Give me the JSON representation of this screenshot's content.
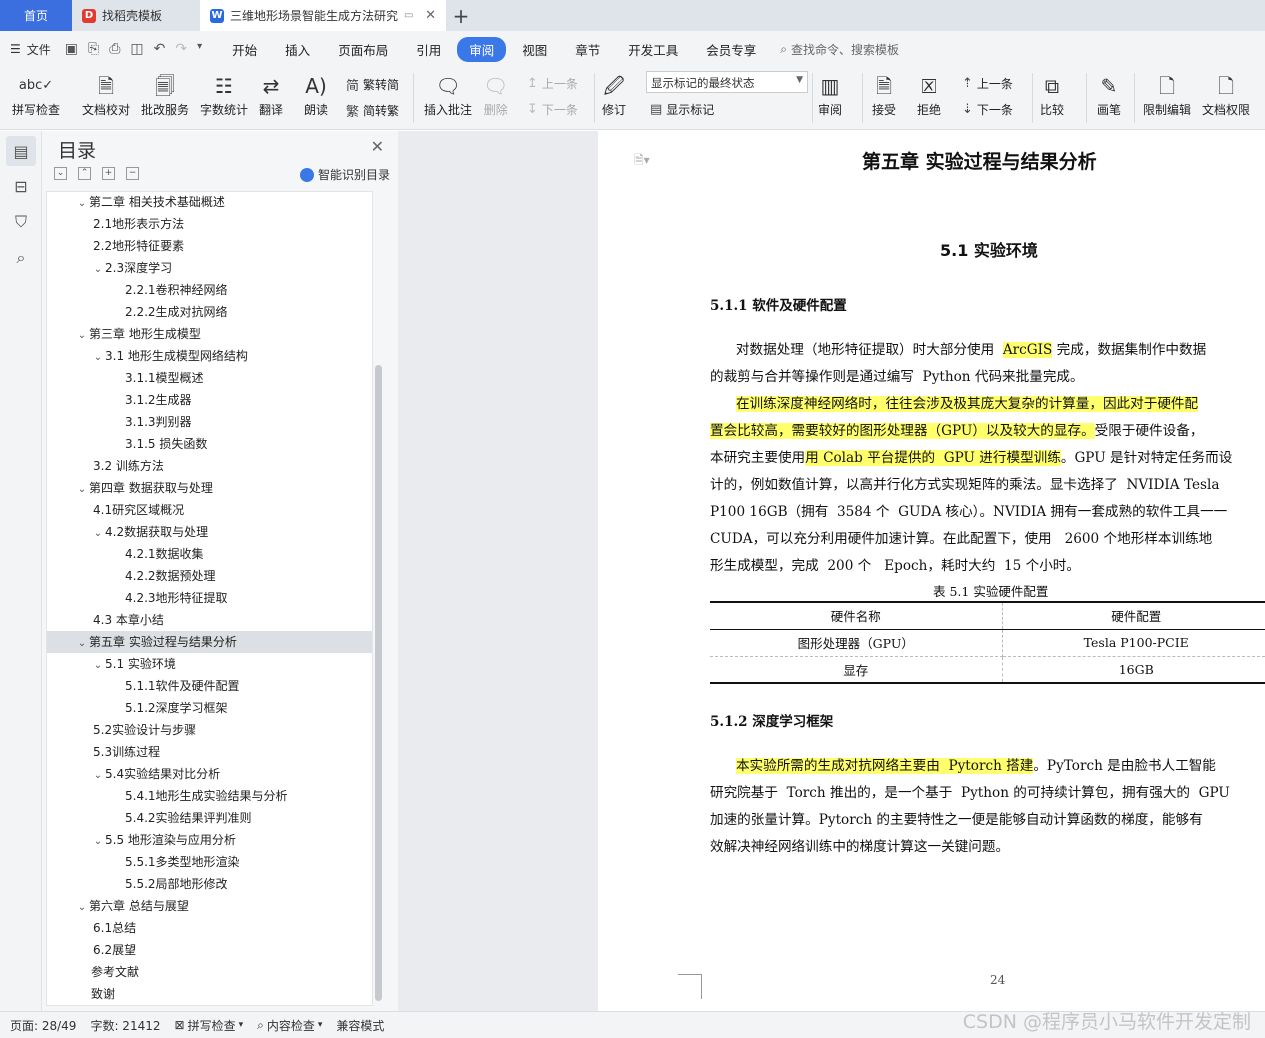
{
  "tabs": {
    "home": "首页",
    "t1": "找稻壳模板",
    "t2": "三维地形场景智能生成方法研究"
  },
  "menubar": {
    "file": "文件",
    "items": [
      "开始",
      "插入",
      "页面布局",
      "引用",
      "审阅",
      "视图",
      "章节",
      "开发工具",
      "会员专享"
    ],
    "active_index": 4,
    "search": "查找命令、搜索模板"
  },
  "ribbon": {
    "spell": "拼写检查",
    "proof": "文档校对",
    "batch": "批改服务",
    "wordcount": "字数统计",
    "translate": "翻译",
    "read": "朗读",
    "trad": "繁转简",
    "simp": "简转繁",
    "insert_comment": "插入批注",
    "delete": "删除",
    "prev": "上一条",
    "next": "下一条",
    "track": "修订",
    "markstate": "显示标记的最终状态",
    "showmarks": "显示标记",
    "review": "审阅",
    "accept": "接受",
    "reject": "拒绝",
    "prev2": "上一条",
    "next2": "下一条",
    "compare": "比较",
    "pen": "画笔",
    "restrict": "限制编辑",
    "rights": "文档权限"
  },
  "toc": {
    "title": "目录",
    "smart": "智能识别目录",
    "items": [
      {
        "level": 1,
        "caret": "v",
        "text": "第二章 相关技术基础概述"
      },
      {
        "level": 2,
        "caret": "",
        "text": "2.1地形表示方法"
      },
      {
        "level": 2,
        "caret": "",
        "text": "2.2地形特征要素"
      },
      {
        "level": 2,
        "caret": "v",
        "text": "2.3深度学习"
      },
      {
        "level": 3,
        "caret": "",
        "text": "2.2.1卷积神经网络"
      },
      {
        "level": 3,
        "caret": "",
        "text": "2.2.2生成对抗网络"
      },
      {
        "level": 1,
        "caret": "v",
        "text": "第三章 地形生成模型"
      },
      {
        "level": 2,
        "caret": "v",
        "text": "3.1 地形生成模型网络结构"
      },
      {
        "level": 3,
        "caret": "",
        "text": "3.1.1模型概述"
      },
      {
        "level": 3,
        "caret": "",
        "text": "3.1.2生成器"
      },
      {
        "level": 3,
        "caret": "",
        "text": "3.1.3判别器"
      },
      {
        "level": 3,
        "caret": "",
        "text": "3.1.5 损失函数"
      },
      {
        "level": 2,
        "caret": "",
        "text": "3.2 训练方法"
      },
      {
        "level": 1,
        "caret": "v",
        "text": "第四章 数据获取与处理"
      },
      {
        "level": 2,
        "caret": "",
        "text": "4.1研究区域概况"
      },
      {
        "level": 2,
        "caret": "v",
        "text": "4.2数据获取与处理"
      },
      {
        "level": 3,
        "caret": "",
        "text": "4.2.1数据收集"
      },
      {
        "level": 3,
        "caret": "",
        "text": "4.2.2数据预处理"
      },
      {
        "level": 3,
        "caret": "",
        "text": "4.2.3地形特征提取"
      },
      {
        "level": 2,
        "caret": "",
        "text": "4.3 本章小结"
      },
      {
        "level": 1,
        "caret": "v",
        "text": "第五章 实验过程与结果分析",
        "selected": true
      },
      {
        "level": 2,
        "caret": "v",
        "text": "5.1 实验环境"
      },
      {
        "level": 3,
        "caret": "",
        "text": "5.1.1软件及硬件配置"
      },
      {
        "level": 3,
        "caret": "",
        "text": "5.1.2深度学习框架"
      },
      {
        "level": 2,
        "caret": "",
        "text": "5.2实验设计与步骤"
      },
      {
        "level": 2,
        "caret": "",
        "text": "5.3训练过程"
      },
      {
        "level": 2,
        "caret": "v",
        "text": "5.4实验结果对比分析"
      },
      {
        "level": 3,
        "caret": "",
        "text": "5.4.1地形生成实验结果与分析"
      },
      {
        "level": 3,
        "caret": "",
        "text": "5.4.2实验结果评判准则"
      },
      {
        "level": 2,
        "caret": "v",
        "text": "5.5 地形渲染与应用分析"
      },
      {
        "level": 3,
        "caret": "",
        "text": "5.5.1多类型地形渲染"
      },
      {
        "level": 3,
        "caret": "",
        "text": "5.5.2局部地形修改"
      },
      {
        "level": 1,
        "caret": "v",
        "text": "第六章 总结与展望"
      },
      {
        "level": 2,
        "caret": "",
        "text": "6.1总结"
      },
      {
        "level": 2,
        "caret": "",
        "text": "6.2展望"
      },
      {
        "level": 1,
        "caret": "",
        "text": "参考文献"
      },
      {
        "level": 1,
        "caret": "",
        "text": "致谢"
      }
    ]
  },
  "doc": {
    "chapter": "第五章  实验过程与结果分析",
    "section": "5.1  实验环境",
    "sub1": "5.1.1   软件及硬件配置",
    "sub2": "5.1.2   深度学习框架",
    "para1": [
      [
        {
          "t": "      对数据处理（地形特征提取）时大部分使用  "
        },
        {
          "t": "ArcGIS",
          "h": true
        },
        {
          "t": " 完成，数据集制作中数据"
        }
      ],
      [
        {
          "t": "的裁剪与合并等操作则是通过编写  Python 代码来批量完成。"
        }
      ],
      [
        {
          "t": "      "
        },
        {
          "t": "在训练深度神经网络时，往往会涉及极其庞大复杂的计算量，因此对于硬件配",
          "h": true
        }
      ],
      [
        {
          "t": "置会比较高，需要较好的图形处理器（GPU）以及较大的显存。",
          "h": true
        },
        {
          "t": "受限于硬件设备，"
        }
      ],
      [
        {
          "t": "本研究主要使用"
        },
        {
          "t": "用 Colab 平台提供的  GPU 进行模型训练",
          "h": true
        },
        {
          "t": "。GPU 是针对特定任务而设"
        }
      ],
      [
        {
          "t": "计的，例如数值计算，以高并行化方式实现矩阵的乘法。显卡选择了  NVIDIA Tesla"
        }
      ],
      [
        {
          "t": "P100 16GB（拥有  3584 个  GUDA 核心）。NVIDIA 拥有一套成熟的软件工具一一"
        }
      ],
      [
        {
          "t": "CUDA，可以充分利用硬件加速计算。在此配置下，使用   2600 个地形样本训练地"
        }
      ],
      [
        {
          "t": "形生成模型，完成  200 个   Epoch，耗时大约  15 个小时。"
        }
      ]
    ],
    "table_caption": "表 5.1 实验硬件配置",
    "table": [
      [
        "硬件名称",
        "硬件配置"
      ],
      [
        "图形处理器（GPU）",
        "Tesla P100-PCIE"
      ],
      [
        "显存",
        "16GB"
      ]
    ],
    "para2": [
      [
        {
          "t": "      "
        },
        {
          "t": "本实验所需的生成对抗网络主要由  Pytorch 搭建",
          "h": true
        },
        {
          "t": "。PyTorch 是由脸书人工智能"
        }
      ],
      [
        {
          "t": "研究院基于  Torch 推出的，是一个基于  Python 的可持续计算包，拥有强大的  GPU"
        }
      ],
      [
        {
          "t": "加速的张量计算。Pytorch 的主要特性之一便是能够自动计算函数的梯度，能够有"
        }
      ],
      [
        {
          "t": "效解决神经网络训练中的梯度计算这一关键问题。"
        }
      ]
    ],
    "page_number": "24"
  },
  "status": {
    "page": "页面: 28/49",
    "words": "字数: 21412",
    "spell": "拼写检查",
    "content": "内容检查",
    "compat": "兼容模式"
  },
  "watermark": "CSDN @程序员小马软件开发定制"
}
